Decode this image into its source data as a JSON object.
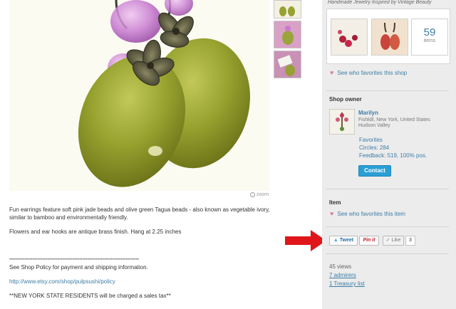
{
  "listing": {
    "zoom_label": "zoom",
    "description": {
      "p1": "Fun earrings feature soft pink jade beads and olive green Tagua beads - also known as vegetable ivory, similar to bamboo and environmentally friendly.",
      "p2": "Flowers and ear hooks are antique brass finish. Hang at 2.25 inches",
      "stars": "******************************************************************************",
      "policy_note": "See Shop Policy for payment and shipping information.",
      "policy_link": "http://www.etsy.com/shop/pulpsushi/policy",
      "tax_note": "**NEW YORK STATE RESIDENTS will be charged a sales tax**"
    }
  },
  "sidebar": {
    "shop_tagline": "Handmade Jewelry Inspired by Vintage Beauty",
    "favorites_count": "59",
    "favorites_count_label": "items",
    "see_shop_favs": "See who favorites this shop",
    "shop_owner_title": "Shop owner",
    "owner": {
      "name": "Marilyn",
      "location": "Fishkill, New York, United States Hudson Valley",
      "favorites": "Favorites",
      "circles": "Circles: 284",
      "feedback": "Feedback: 519, 100% pos.",
      "contact": "Contact"
    },
    "item_title": "Item",
    "see_item_favs": "See who favorites this item",
    "social": {
      "tweet": "Tweet",
      "pinit": "Pin it",
      "like": "Like",
      "like_count": "3"
    },
    "stats": {
      "views": "45 views",
      "admirers": "7 admirers",
      "treasury": "1 Treasury list"
    }
  },
  "colors": {
    "link": "#3c7da6",
    "contact_button": "#2a9fd6",
    "annotation_arrow": "#e0161b",
    "olive_bead": "#8e9a2a",
    "pink_bead": "#c77ad0"
  }
}
